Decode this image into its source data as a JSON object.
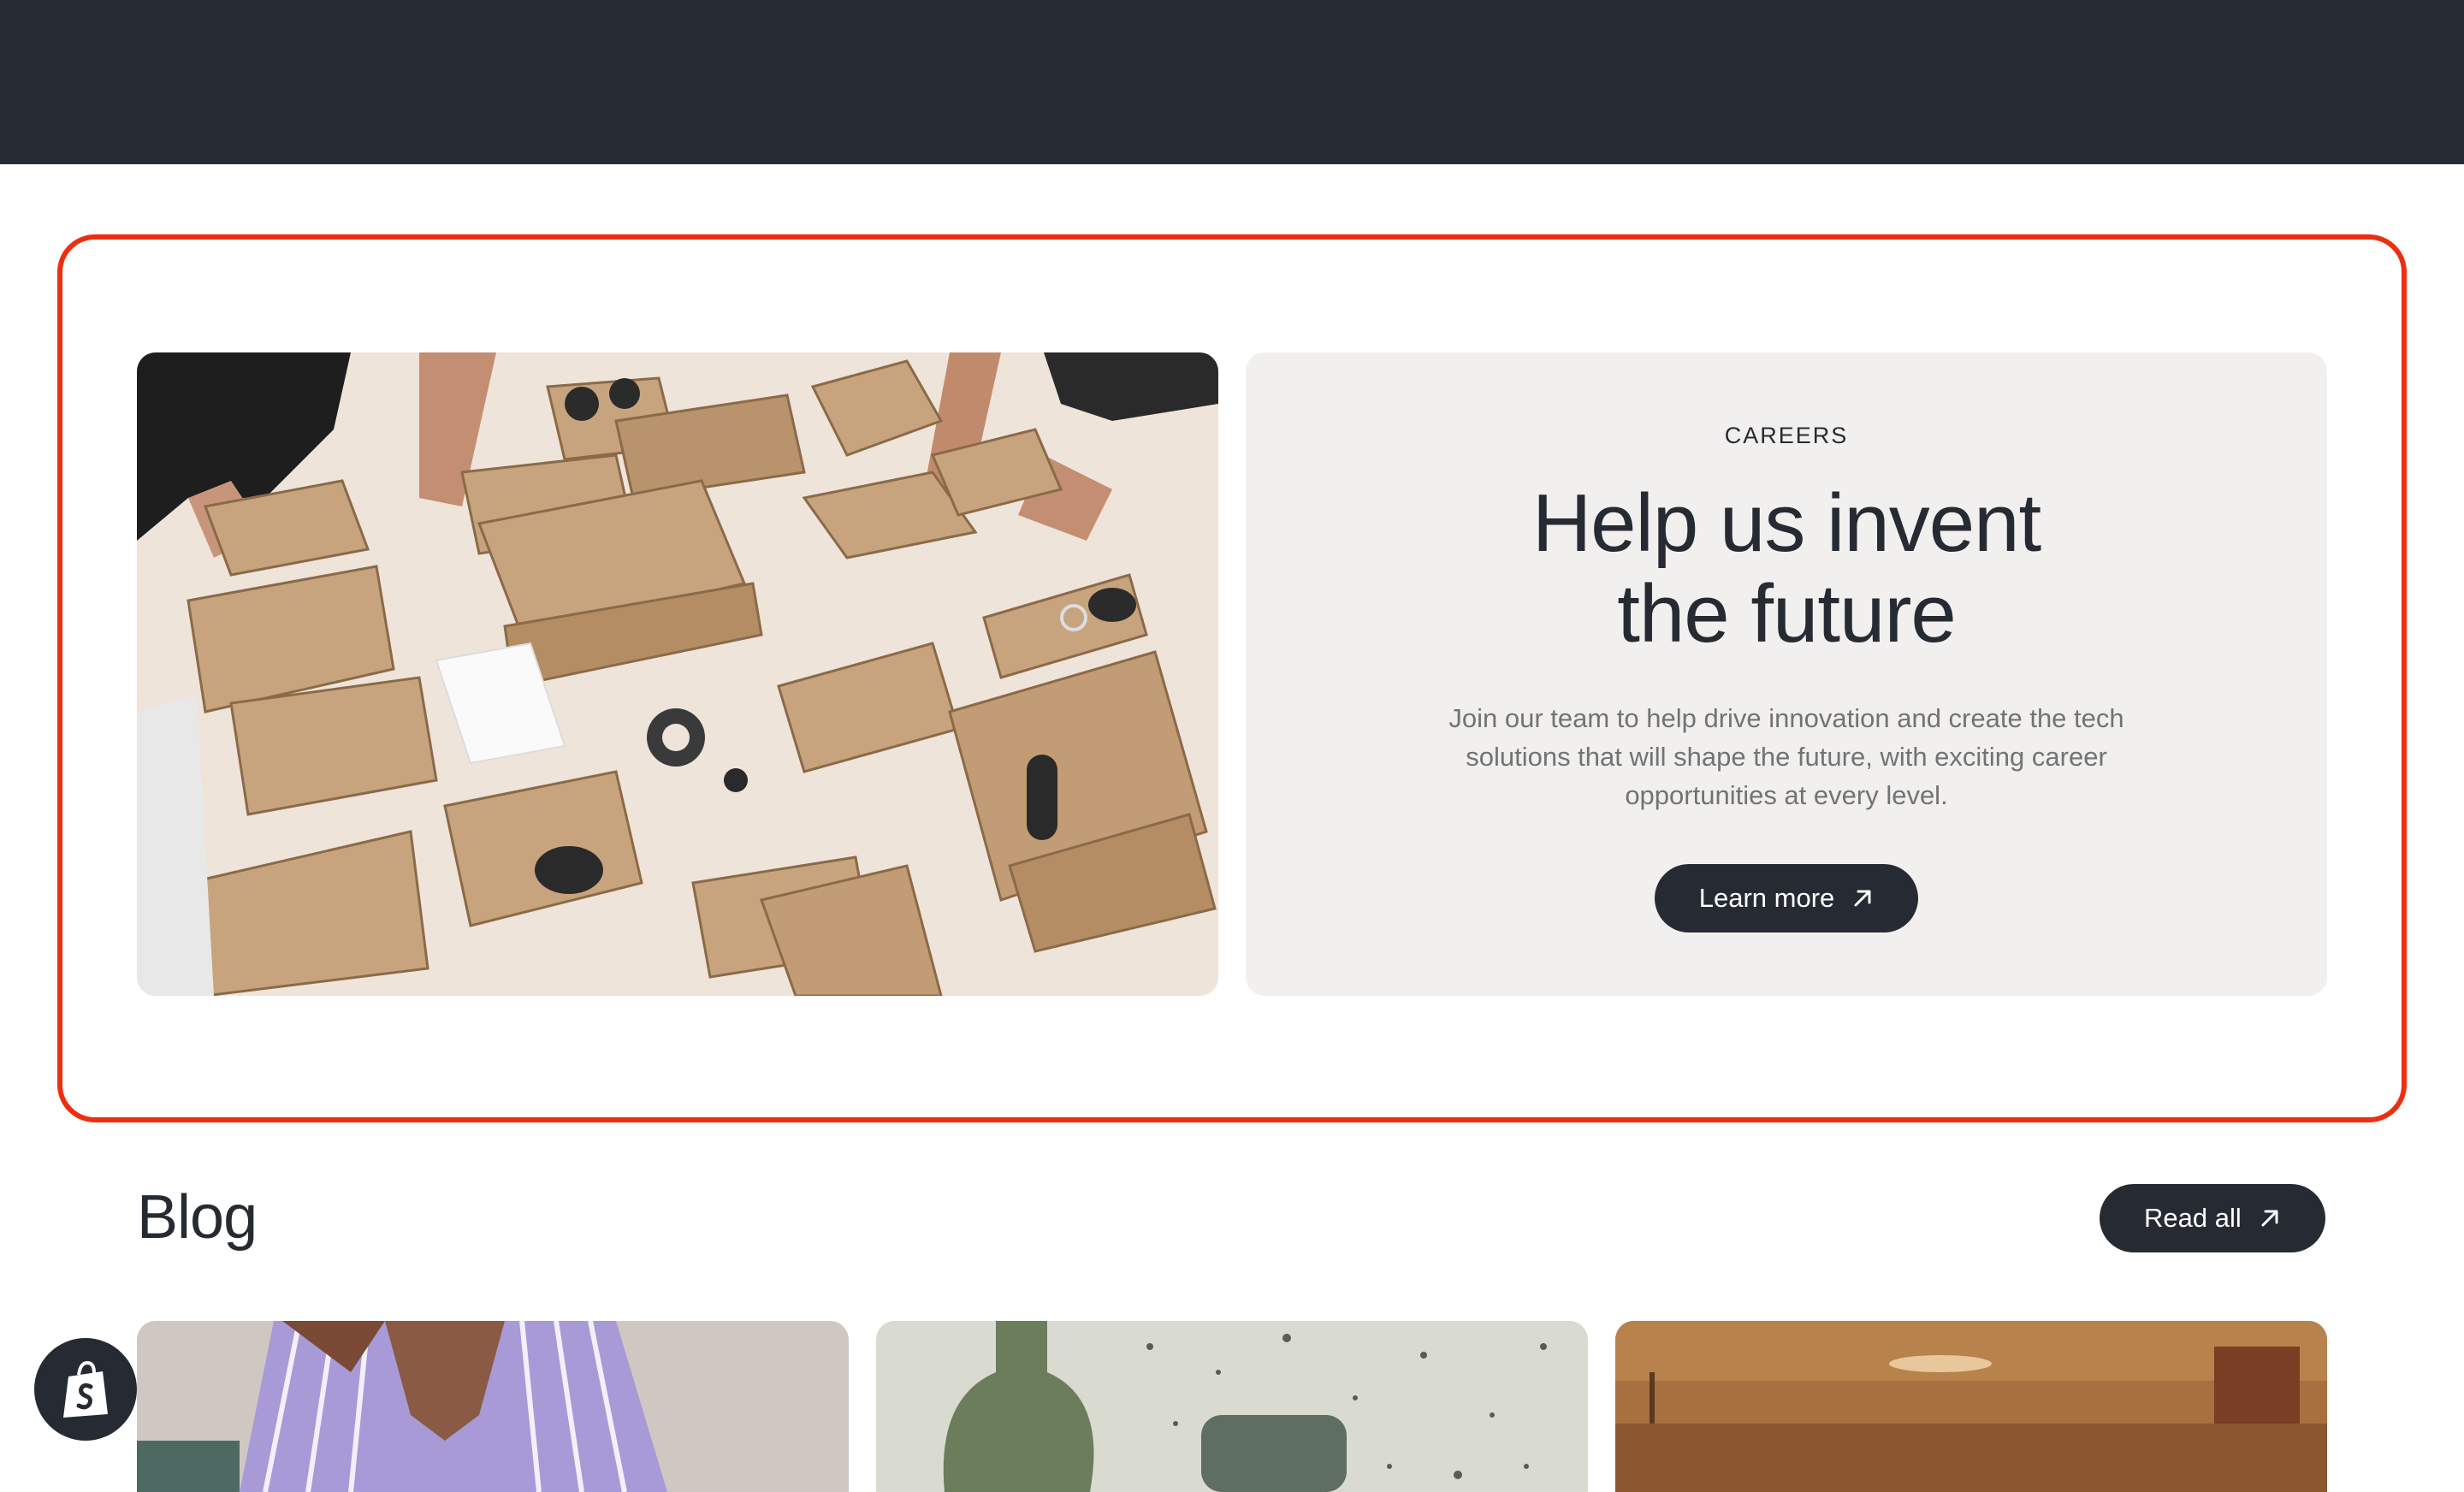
{
  "careers": {
    "eyebrow": "CAREERS",
    "headline_line1": "Help us invent",
    "headline_line2": "the future",
    "body": "Join our team to help drive innovation and create the tech solutions that will shape the future, with exciting career opportunities at every level.",
    "cta_label": "Learn more",
    "cta_icon": "arrow-up-right-icon",
    "image": "cardboard-speaker-prototypes-photo"
  },
  "blog": {
    "title": "Blog",
    "read_all_label": "Read all",
    "read_all_icon": "arrow-up-right-icon",
    "cards": [
      {
        "image": "person-striped-shirt-photo"
      },
      {
        "image": "green-vase-speaker-photo"
      },
      {
        "image": "warm-interior-room-photo"
      }
    ]
  },
  "shopify_badge": {
    "icon": "shopify-bag-icon"
  },
  "colors": {
    "nav_bg": "#262b33",
    "card_bg": "#f1f0ee",
    "button_bg": "#262b33",
    "highlight_border": "#ec2f10",
    "body_text": "#727373"
  }
}
